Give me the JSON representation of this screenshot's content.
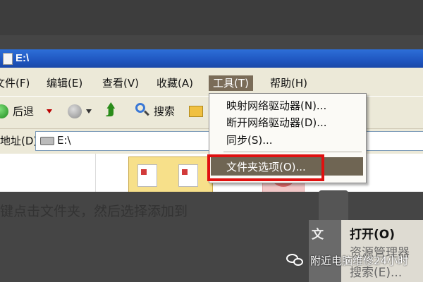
{
  "window": {
    "title": "E:\\",
    "menu": [
      "文件(F)",
      "编辑(E)",
      "查看(V)",
      "收藏(A)",
      "工具(T)",
      "帮助(H)"
    ],
    "active_menu_index": 4
  },
  "toolbar": {
    "back_label": "后退",
    "search_label": "搜索"
  },
  "address": {
    "label": "地址(D)",
    "value": "E:\\"
  },
  "tools_menu": {
    "items": [
      "映射网络驱动器(N)...",
      "断开网络驱动器(D)...",
      "同步(S)...",
      "文件夹选项(O)..."
    ],
    "highlighted_index": 3
  },
  "caption": "键点击文件夹，然后选择添加到",
  "context_menu": {
    "left_glyph": "文",
    "items": [
      "打开(O)",
      "资源管理器",
      "搜索(E)..."
    ]
  },
  "watermark": {
    "text": "附近电脑维修24小时",
    "icon": "wechat-icon"
  },
  "colors": {
    "highlight": "#6f6553",
    "red_box": "#e01010",
    "titlebar": "#2d6fd8"
  }
}
